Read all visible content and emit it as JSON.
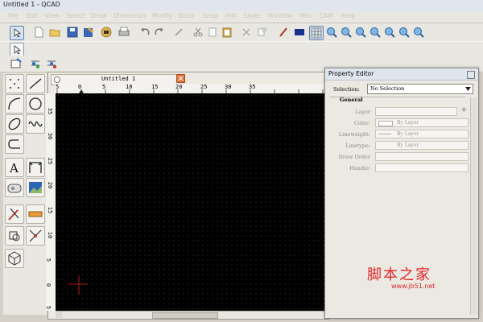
{
  "window": {
    "title": "Untitled 1 - QCAD"
  },
  "menu": [
    "File",
    "Edit",
    "View",
    "Select",
    "Draw",
    "Dimension",
    "Modify",
    "Block",
    "Snap",
    "Info",
    "Layer",
    "Window",
    "Misc",
    "CAM",
    "Help"
  ],
  "document": {
    "tab_title": "Untitled 1"
  },
  "ruler": {
    "h_ticks": [
      "5",
      "0",
      "5",
      "10",
      "15",
      "20",
      "25",
      "30",
      "35"
    ],
    "v_ticks": [
      "35",
      "30",
      "25",
      "20",
      "15",
      "10",
      "5",
      "0",
      "5"
    ]
  },
  "property_editor": {
    "title": "Property Editor",
    "selection_label": "Selection:",
    "selection_value": "No Selection",
    "section": "General",
    "layer_label": "Layer",
    "color_label": "Color:",
    "color_value": "By Layer",
    "lineweight_label": "Lineweight:",
    "lineweight_value": "By Layer",
    "linetype_label": "Linetype:",
    "linetype_value": "By Layer",
    "draw_order_label": "Draw Order",
    "handle_label": "Handle:"
  },
  "watermark": {
    "cn": "脚本之家",
    "url": "www.jb51.net"
  }
}
